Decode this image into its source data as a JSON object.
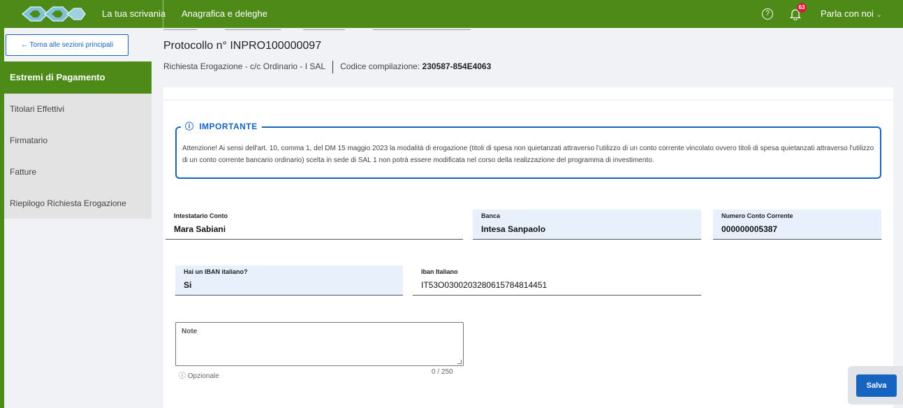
{
  "topbar": {
    "nav": [
      "La tua scrivania",
      "Anagrafica e deleghe"
    ],
    "help_icon": "?",
    "notifications_count": "63",
    "chat_label": "Parla con noi",
    "chat_chevron": "⌄"
  },
  "sidebar": {
    "back_label": "← Torna alle sezioni principali",
    "items": [
      {
        "label": "Estremi di Pagamento",
        "active": true
      },
      {
        "label": "Titolari Effettivi",
        "active": false
      },
      {
        "label": "Firmatario",
        "active": false
      },
      {
        "label": "Fatture",
        "active": false
      },
      {
        "label": "Riepilogo Richiesta Erogazione",
        "active": false
      }
    ]
  },
  "header": {
    "title": "Protocollo n° INPRO100000097",
    "request_type": "Richiesta Erogazione - c/c Ordinario - I SAL",
    "code_label": "Codice compilazione:",
    "code_value": "230587-854E4063"
  },
  "important": {
    "icon": "ⓘ",
    "title": "IMPORTANTE",
    "text": "Attenzione! Ai sensi dell'art. 10, comma 1, del DM 15 maggio 2023 la modalità di erogazione (titoli di spesa non quietanzati attraverso l'utilizzo di un conto corrente vincolato ovvero titoli di spesa quietanzati attraverso l'utilizzo di un conto corrente bancario ordinario) scelta in sede di SAL 1 non potrà essere modificata nel corso della realizzazione del programma di investimento."
  },
  "fields": {
    "intestatario": {
      "label": "Intestatario Conto",
      "value": "Mara Sabiani"
    },
    "banca": {
      "label": "Banca",
      "value": "Intesa Sanpaolo"
    },
    "numero_conto": {
      "label": "Numero Conto Corrente",
      "value": "000000005387"
    },
    "iban_italiano_q": {
      "label": "Hai un IBAN italiano?",
      "value": "Si"
    },
    "iban": {
      "label": "Iban Italiano",
      "value": "IT53O0300203280615784814451"
    }
  },
  "note": {
    "label": "Note",
    "hint": "ⓘ  Opzionale",
    "counter": "0 / 250"
  },
  "actions": {
    "save_label": "Salva"
  },
  "colors": {
    "brand_green": "#4e8a18",
    "primary_blue": "#1565c0",
    "badge_red": "#d81b3c"
  }
}
